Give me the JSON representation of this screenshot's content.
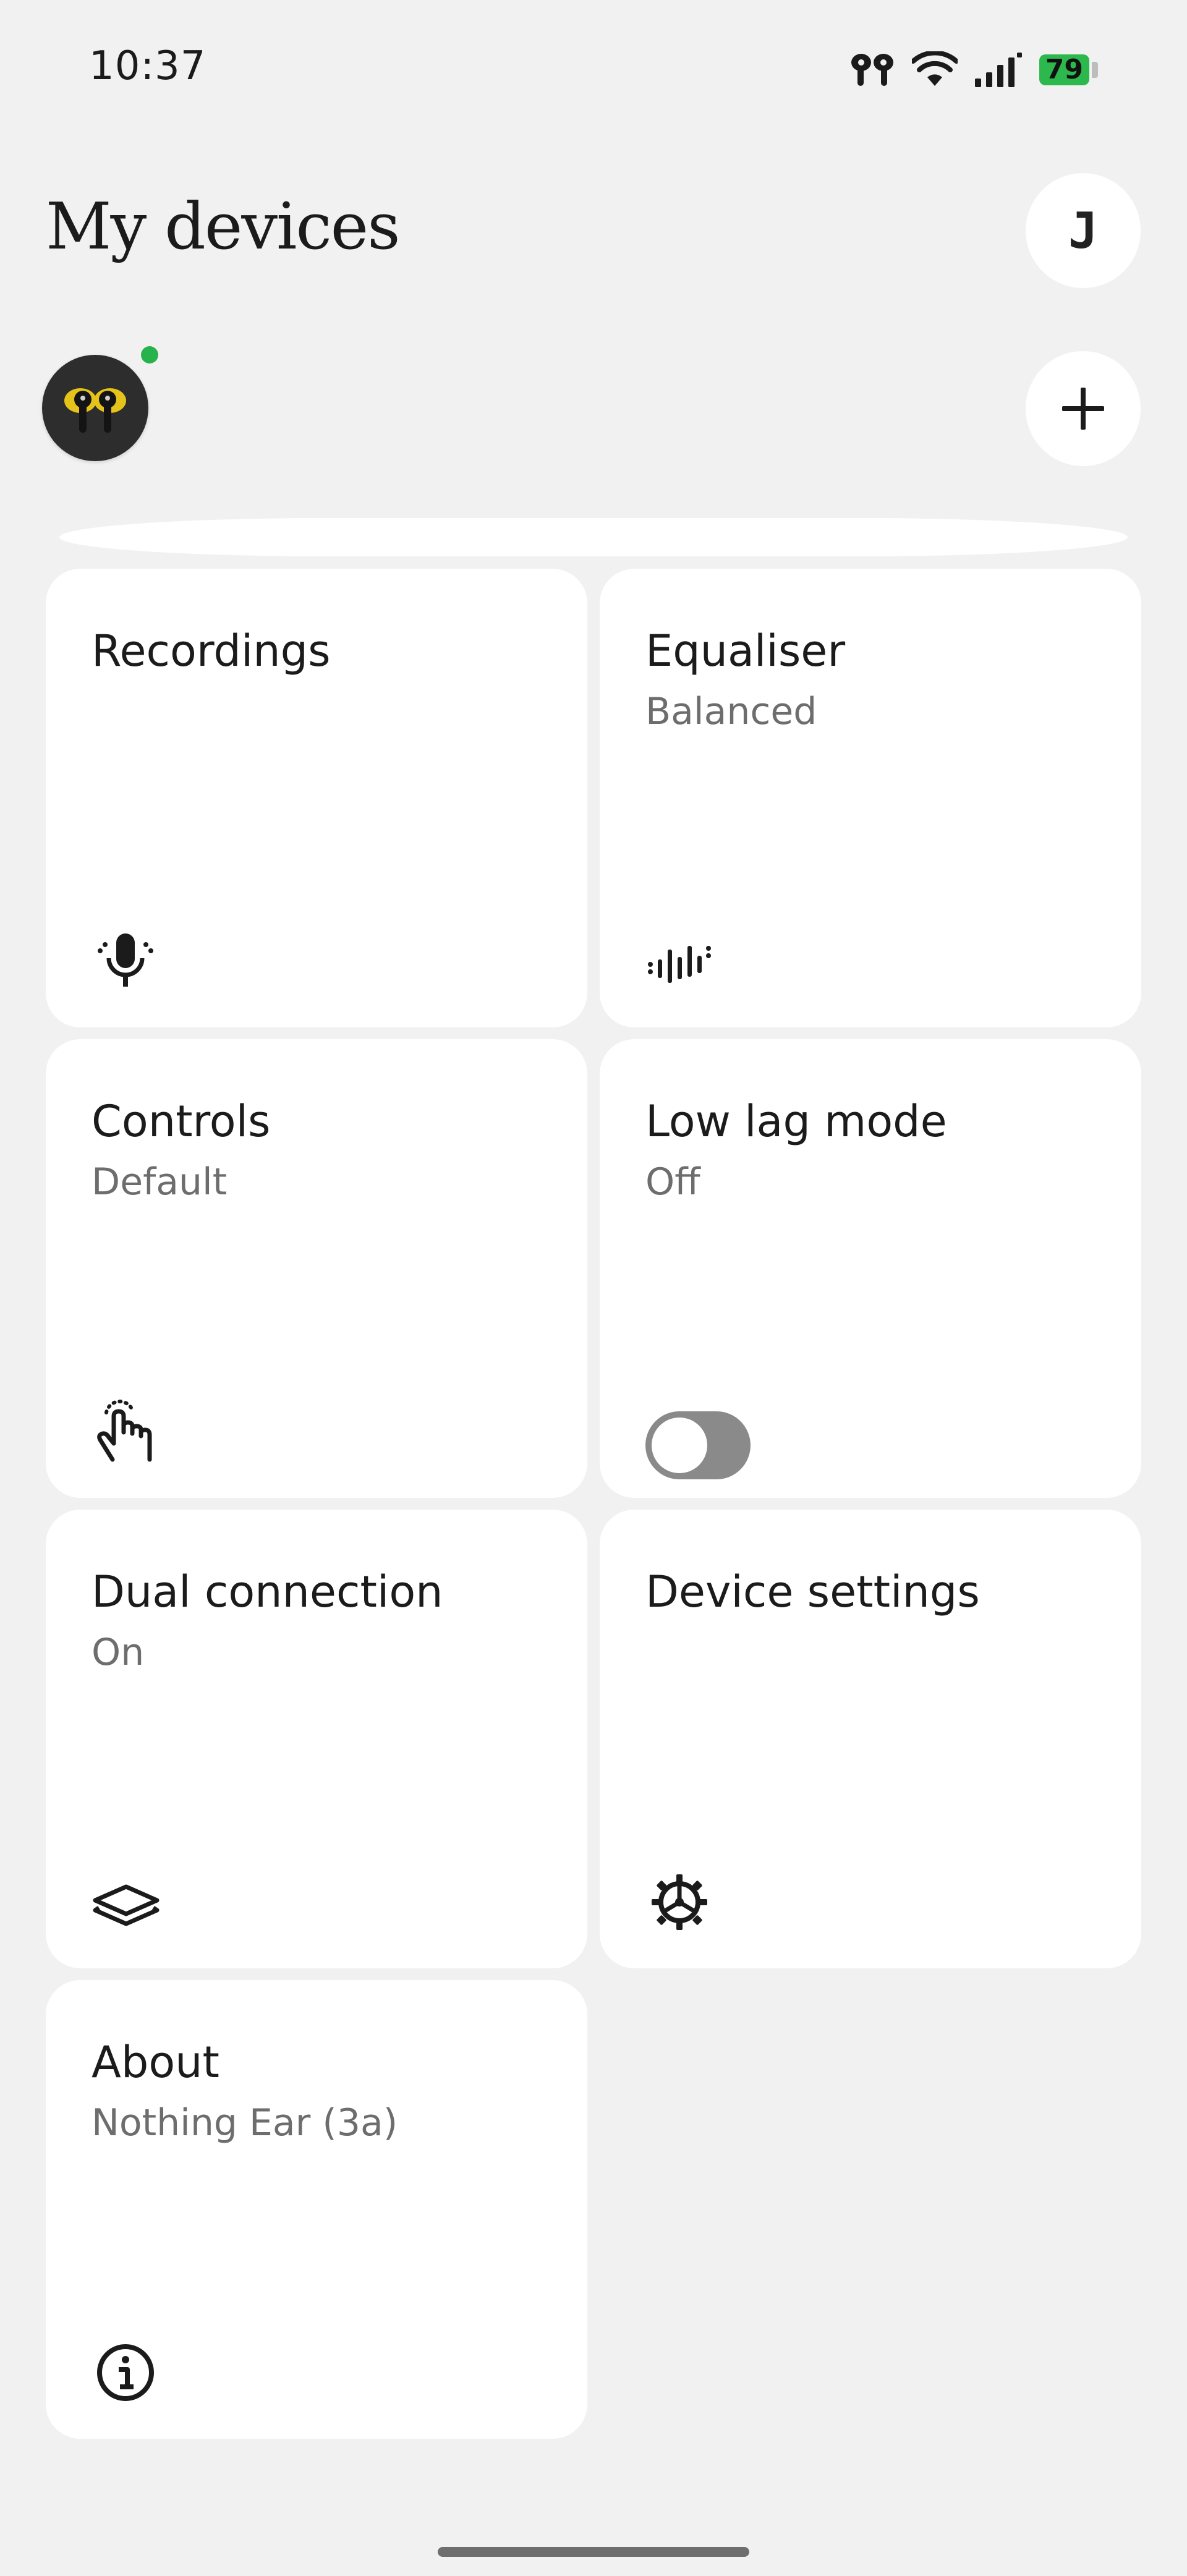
{
  "status_bar": {
    "time": "10:37",
    "battery": "79",
    "icons": [
      "earbuds-icon",
      "wifi-icon",
      "signal-icon",
      "battery-icon"
    ]
  },
  "header": {
    "title": "My devices",
    "avatar_initial": "J"
  },
  "colors": {
    "background": "#f1f1f1",
    "tile": "#ffffff",
    "online": "#27b34b",
    "battery": "#2db84d",
    "secondary_text": "#6d6d6d"
  },
  "tiles": {
    "recordings": {
      "title": "Recordings",
      "icon": "microphone-icon"
    },
    "equaliser": {
      "title": "Equaliser",
      "subtitle": "Balanced",
      "icon": "waveform-icon"
    },
    "controls": {
      "title": "Controls",
      "subtitle": "Default",
      "icon": "tap-gesture-icon"
    },
    "low_lag": {
      "title": "Low lag mode",
      "subtitle": "Off",
      "toggle_on": false
    },
    "dual_connection": {
      "title": "Dual connection",
      "subtitle": "On",
      "icon": "layers-icon"
    },
    "device_settings": {
      "title": "Device settings",
      "icon": "gear-icon"
    },
    "about": {
      "title": "About",
      "subtitle": "Nothing Ear (3a)",
      "icon": "info-icon"
    }
  }
}
